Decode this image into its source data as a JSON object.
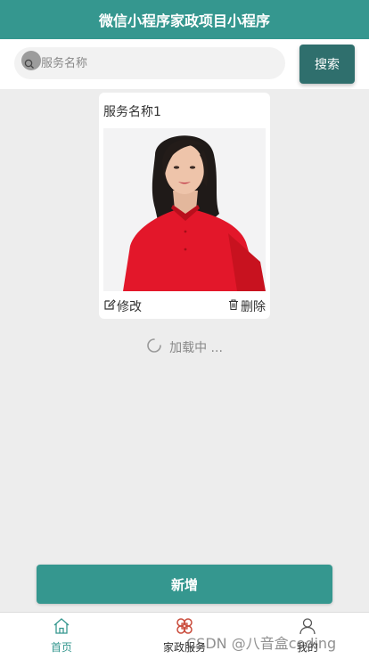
{
  "colors": {
    "primary": "#35978f",
    "search_button": "#2f6f6d",
    "background": "#ededed",
    "active_tab": "#35978f",
    "service_icon": "#c94a3a"
  },
  "navbar": {
    "title": "微信小程序家政项目小程序"
  },
  "search": {
    "placeholder": "服务名称",
    "value": "",
    "button_label": "搜索",
    "icon": "search-icon"
  },
  "service_list": [
    {
      "name": "服务名称1",
      "image": "woman-portrait-red-shirt",
      "edit_label": "修改",
      "edit_icon": "edit-icon",
      "delete_label": "删除",
      "delete_icon": "trash-icon"
    }
  ],
  "loading": {
    "text": "加载中 ..."
  },
  "add_button": {
    "label": "新增"
  },
  "tabbar": {
    "tabs": [
      {
        "label": "首页",
        "icon": "home-icon",
        "active": true
      },
      {
        "label": "家政服务",
        "icon": "service-grid-icon",
        "active": false
      },
      {
        "label": "我的",
        "icon": "user-icon",
        "active": false
      }
    ]
  },
  "watermark": {
    "text": "CSDN @八音盒coding"
  }
}
